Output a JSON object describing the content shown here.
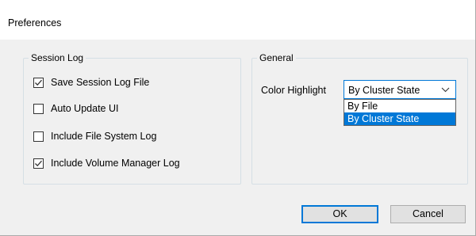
{
  "window": {
    "title": "Preferences"
  },
  "session_log": {
    "title": "Session Log",
    "options": [
      {
        "label": "Save Session Log File",
        "checked": true
      },
      {
        "label": "Auto Update UI",
        "checked": false
      },
      {
        "label": "Include File System Log",
        "checked": false
      },
      {
        "label": "Include Volume Manager Log",
        "checked": true
      }
    ]
  },
  "general": {
    "title": "General",
    "color_highlight_label": "Color Highlight",
    "color_highlight_value": "By Cluster State",
    "dropdown_options": [
      {
        "label": "By File",
        "selected": false
      },
      {
        "label": "By Cluster State",
        "selected": true
      }
    ]
  },
  "buttons": {
    "ok": "OK",
    "cancel": "Cancel"
  },
  "colors": {
    "accent": "#0078d7",
    "dialog_bg": "#f0f0f0",
    "title_bg": "#ffffff",
    "group_border": "#d5dfe5",
    "button_bg": "#e1e1e1"
  },
  "icons": {
    "checkmark": "check-icon",
    "chevron": "chevron-down-icon"
  }
}
